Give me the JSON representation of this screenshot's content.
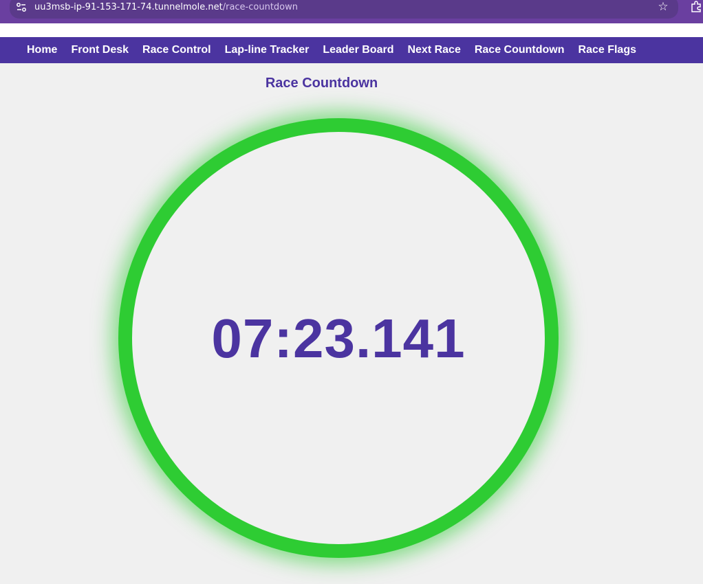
{
  "browser": {
    "url_host": "uu3msb-ip-91-153-171-74.tunnelmole.net",
    "url_path": "/race-countdown",
    "icons": {
      "site_settings": "tune-icon",
      "bookmark": "star-icon",
      "extensions": "puzzle-icon"
    }
  },
  "nav": {
    "items": [
      {
        "label": "Home"
      },
      {
        "label": "Front Desk"
      },
      {
        "label": "Race Control"
      },
      {
        "label": "Lap-line Tracker"
      },
      {
        "label": "Leader Board"
      },
      {
        "label": "Next Race"
      },
      {
        "label": "Race Countdown"
      },
      {
        "label": "Race Flags"
      }
    ]
  },
  "page": {
    "title": "Race Countdown"
  },
  "countdown": {
    "time": "07:23.141"
  },
  "colors": {
    "accent": "#4b34a0",
    "ring": "#2ecc33",
    "background": "#f0f0f0",
    "browser_frame": "#6a3fa0"
  }
}
